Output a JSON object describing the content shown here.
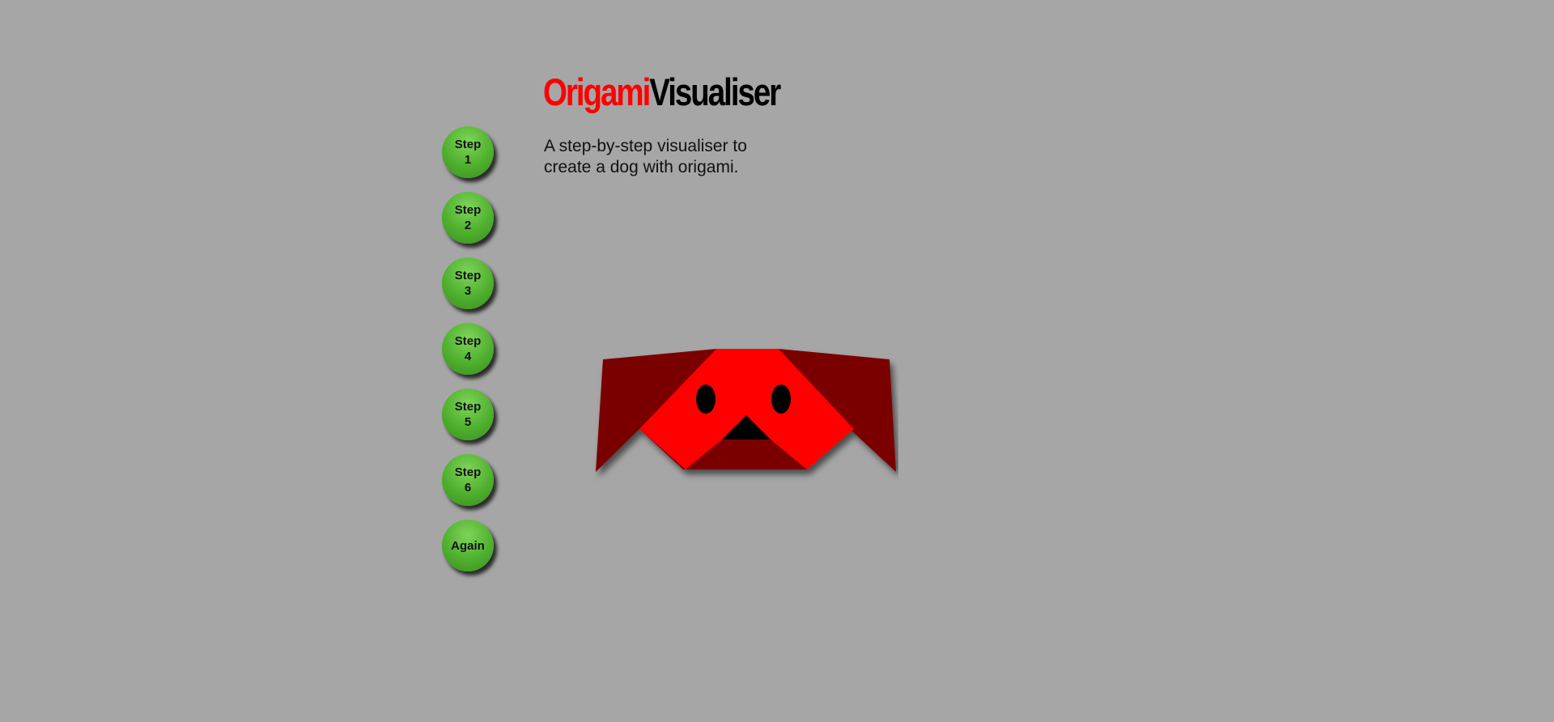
{
  "header": {
    "title_part1": "Origami",
    "title_part2": "Visualiser",
    "description": "A step-by-step visualiser to create a dog with origami."
  },
  "steps": [
    {
      "label": "Step 1"
    },
    {
      "label": "Step 2"
    },
    {
      "label": "Step 3"
    },
    {
      "label": "Step 4"
    },
    {
      "label": "Step 5"
    },
    {
      "label": "Step 6"
    },
    {
      "label": "Again"
    }
  ],
  "colors": {
    "background": "#a6a6a6",
    "title_accent": "#ff0000",
    "button_green": "#4fb02e",
    "dog_face": "#ff0000",
    "dog_ears": "#7a0000"
  }
}
